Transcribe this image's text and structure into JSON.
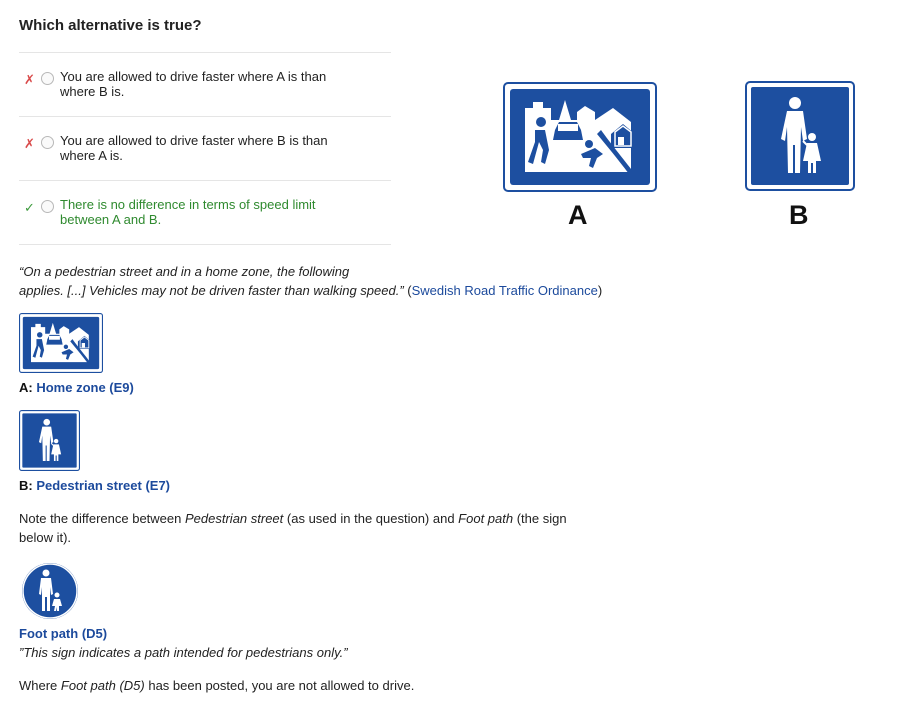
{
  "question": "Which alternative is true?",
  "options": [
    {
      "line1": "You are allowed to drive faster where A is than",
      "line2": "where B is.",
      "mark": "✗",
      "status": "wrong"
    },
    {
      "line1": "You are allowed to drive faster where B is than",
      "line2": "where A is.",
      "mark": "✗",
      "status": "wrong"
    },
    {
      "line1": "There is no difference in terms of speed limit",
      "line2": "between A and B.",
      "mark": "✓",
      "status": "correct"
    }
  ],
  "signs": {
    "a_letter": "A",
    "b_letter": "B"
  },
  "quote": {
    "line1": "“On a pedestrian street and in a home zone, the following",
    "line2": "applies. [...] Vehicles may not be driven faster than walking speed.”",
    "source_open": " (",
    "source_link": "Swedish Road Traffic Ordinance",
    "source_close": ")"
  },
  "caption_a": {
    "prefix": "A: ",
    "link": "Home zone (E9)"
  },
  "caption_b": {
    "prefix": "B: ",
    "link": "Pedestrian street (E7)"
  },
  "note": {
    "p1": "Note the difference between ",
    "em1": "Pedestrian street",
    "p2": " (as used in the question) and ",
    "em2": "Foot path",
    "p3": " (the sign",
    "p4": "below it)."
  },
  "foot_path": {
    "title": "Foot path (D5)",
    "desc": "”This sign indicates a path intended for pedestrians only.”"
  },
  "final": {
    "p1": "Where ",
    "em": "Foot path (D5)",
    "p2": " has been posted, you are not allowed to drive."
  },
  "colors": {
    "sign_blue": "#1d4fa0",
    "link": "#1c4a9c",
    "correct": "#2f8a2f",
    "wrong": "#d94a4a"
  }
}
